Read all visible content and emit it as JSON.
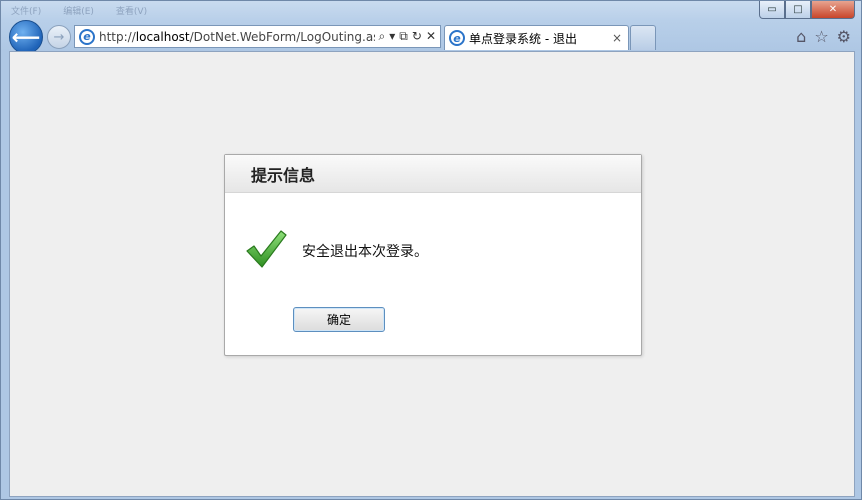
{
  "browser": {
    "menu_ghost": [
      "文件(F)",
      "编辑(E)",
      "查看(V)"
    ],
    "window_buttons": {
      "minimize": "▭",
      "maximize": "□",
      "close": "✕"
    },
    "address": {
      "scheme": "http://",
      "host": "localhost",
      "path": "/DotNet.WebForm/LogOuting.asp",
      "tools": [
        "⌕",
        "▾",
        "⧉",
        "↻",
        "✕"
      ]
    },
    "tabs": [
      {
        "label": "单点登录系统 - 退出",
        "close": "×"
      }
    ],
    "toolbar_icons": [
      "home-icon",
      "star-icon",
      "gear-icon"
    ],
    "toolbar_glyphs": [
      "⌂",
      "☆",
      "⚙"
    ]
  },
  "dialog": {
    "title": "提示信息",
    "message": "安全退出本次登录。",
    "ok_label": "确定"
  },
  "colors": {
    "accent": "#2b74c9",
    "check_green": "#3aa82a"
  }
}
